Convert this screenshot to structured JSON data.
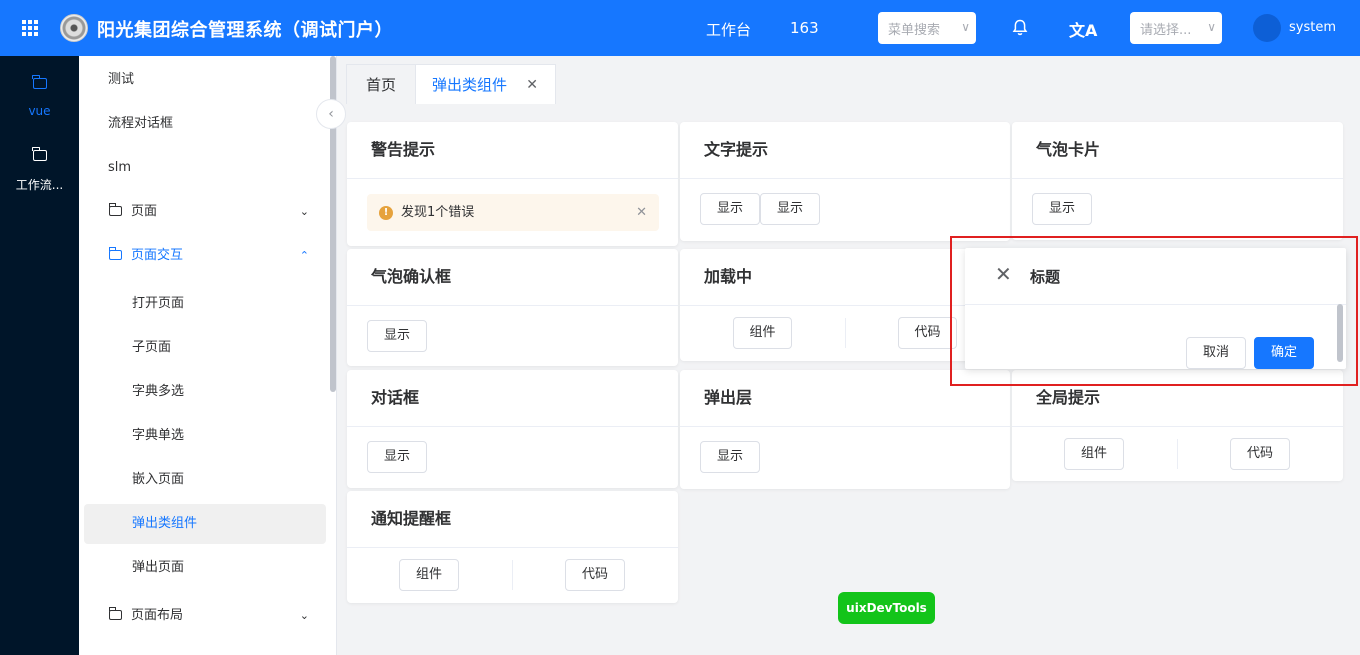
{
  "header": {
    "title": "阳光集团综合管理系统（调试门户）",
    "workbench": "工作台",
    "count": "163",
    "menu_search_placeholder": "菜单搜索",
    "select_placeholder": "请选择...",
    "user": "system"
  },
  "rail": {
    "items": [
      {
        "label": "vue",
        "icon": "folder-icon"
      },
      {
        "label": "工作流...",
        "icon": "folder-icon"
      }
    ]
  },
  "sidebar": {
    "items": [
      {
        "label": "测试"
      },
      {
        "label": "流程对话框"
      },
      {
        "label": "slm"
      },
      {
        "label": "页面"
      },
      {
        "label": "页面交互"
      },
      {
        "label": "打开页面"
      },
      {
        "label": "子页面"
      },
      {
        "label": "字典多选"
      },
      {
        "label": "字典单选"
      },
      {
        "label": "嵌入页面"
      },
      {
        "label": "弹出类组件"
      },
      {
        "label": "弹出页面"
      },
      {
        "label": "页面布局"
      }
    ]
  },
  "tabs": [
    {
      "label": "首页"
    },
    {
      "label": "弹出类组件"
    }
  ],
  "cards": {
    "alert": {
      "title": "警告提示",
      "message": "发现1个错误"
    },
    "text_tip": {
      "title": "文字提示",
      "btn1": "显示",
      "btn2": "显示"
    },
    "bubble_card": {
      "title": "气泡卡片",
      "btn": "显示"
    },
    "bubble_confirm": {
      "title": "气泡确认框",
      "btn": "显示"
    },
    "loading": {
      "title": "加载中",
      "component": "组件",
      "code": "代码"
    },
    "dialog": {
      "title": "对话框",
      "btn": "显示"
    },
    "popup_layer": {
      "title": "弹出层",
      "btn": "显示"
    },
    "global_tip": {
      "title": "全局提示",
      "component": "组件",
      "code": "代码"
    },
    "notification": {
      "title": "通知提醒框",
      "component": "组件",
      "code": "代码"
    }
  },
  "popover": {
    "title": "标题",
    "cancel": "取消",
    "confirm": "确定"
  },
  "devtools": {
    "label": "uixDevTools"
  },
  "colors": {
    "primary": "#1677ff",
    "rail_bg": "#001529",
    "highlight": "#e02020",
    "devtools": "#13c41a"
  }
}
